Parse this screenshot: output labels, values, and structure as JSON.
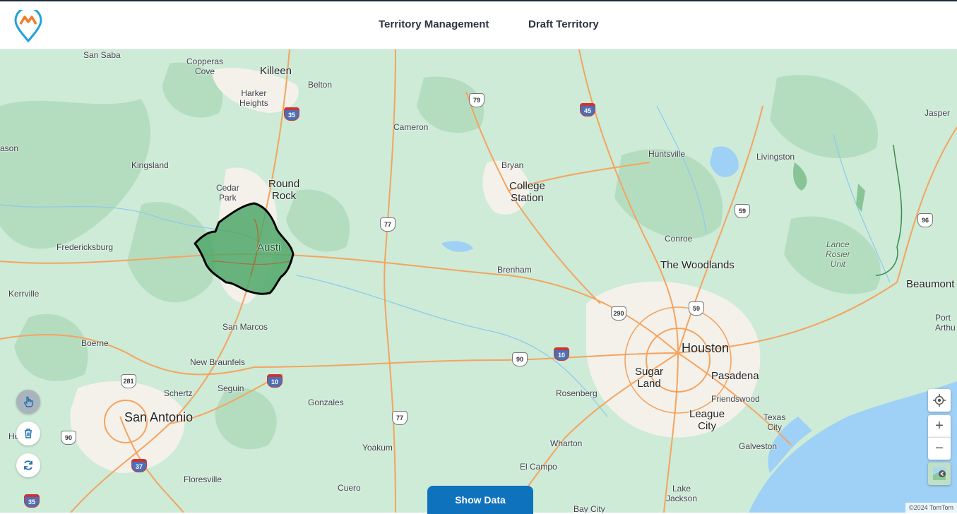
{
  "header": {
    "nav": [
      "Territory Management",
      "Draft Territory"
    ]
  },
  "map": {
    "cities": [
      {
        "name": "San Saba",
        "size": "s"
      },
      {
        "name": "Copperas\nCove",
        "size": "s"
      },
      {
        "name": "Killeen",
        "size": "m"
      },
      {
        "name": "Belton",
        "size": "s"
      },
      {
        "name": "Harker\nHeights",
        "size": "s"
      },
      {
        "name": "Cameron",
        "size": "s"
      },
      {
        "name": "Jasper",
        "size": "s"
      },
      {
        "name": "ason",
        "size": "s"
      },
      {
        "name": "Kingsland",
        "size": "s"
      },
      {
        "name": "Huntsville",
        "size": "s"
      },
      {
        "name": "Livingston",
        "size": "s"
      },
      {
        "name": "Bryan",
        "size": "s"
      },
      {
        "name": "College\nStation",
        "size": "m"
      },
      {
        "name": "Cedar\nPark",
        "size": "s"
      },
      {
        "name": "Round\nRock",
        "size": "m"
      },
      {
        "name": "Fredericksburg",
        "size": "s"
      },
      {
        "name": "Austi",
        "size": "m"
      },
      {
        "name": "Conroe",
        "size": "s"
      },
      {
        "name": "The Woodlands",
        "size": "m"
      },
      {
        "name": "Brenham",
        "size": "s"
      },
      {
        "name": "Kerrville",
        "size": "s"
      },
      {
        "name": "Beaumont",
        "size": "m"
      },
      {
        "name": "Port\nArthu",
        "size": "s"
      },
      {
        "name": "San Marcos",
        "size": "s"
      },
      {
        "name": "Houston",
        "size": "b"
      },
      {
        "name": "Boerne",
        "size": "s"
      },
      {
        "name": "New Braunfels",
        "size": "s"
      },
      {
        "name": "Sugar\nLand",
        "size": "m"
      },
      {
        "name": "Pasadena",
        "size": "m"
      },
      {
        "name": "Schertz",
        "size": "s"
      },
      {
        "name": "Seguin",
        "size": "s"
      },
      {
        "name": "Rosenberg",
        "size": "s"
      },
      {
        "name": "Friendswood",
        "size": "s"
      },
      {
        "name": "Gonzales",
        "size": "s"
      },
      {
        "name": "San Antonio",
        "size": "b"
      },
      {
        "name": "League\nCity",
        "size": "m"
      },
      {
        "name": "Texas\nCity",
        "size": "s"
      },
      {
        "name": "Ho",
        "size": "s"
      },
      {
        "name": "Yoakum",
        "size": "s"
      },
      {
        "name": "Wharton",
        "size": "s"
      },
      {
        "name": "Galveston",
        "size": "s"
      },
      {
        "name": "El Campo",
        "size": "s"
      },
      {
        "name": "Floresville",
        "size": "s"
      },
      {
        "name": "Cuero",
        "size": "s"
      },
      {
        "name": "Lake\nJackson",
        "size": "s"
      },
      {
        "name": "Bay City",
        "size": "s"
      }
    ],
    "park_label": "Lance\nRosier\nUnit",
    "shields": [
      {
        "num": "35",
        "type": "int"
      },
      {
        "num": "79",
        "type": "us"
      },
      {
        "num": "45",
        "type": "int"
      },
      {
        "num": "59",
        "type": "us"
      },
      {
        "num": "96",
        "type": "us"
      },
      {
        "num": "77",
        "type": "us"
      },
      {
        "num": "290",
        "type": "us"
      },
      {
        "num": "59",
        "type": "us"
      },
      {
        "num": "90",
        "type": "us"
      },
      {
        "num": "10",
        "type": "int"
      },
      {
        "num": "281",
        "type": "us"
      },
      {
        "num": "10",
        "type": "int"
      },
      {
        "num": "77",
        "type": "us"
      },
      {
        "num": "90",
        "type": "us"
      },
      {
        "num": "37",
        "type": "int"
      },
      {
        "num": "35",
        "type": "int"
      }
    ],
    "attribution": "©2024 TomTom"
  },
  "tools": {
    "icons": [
      "hand-pointer-icon",
      "trash-icon",
      "refresh-icon"
    ]
  },
  "controls": {
    "icons": [
      "locate-icon",
      "zoom-in-icon",
      "zoom-out-icon",
      "map-style-icon"
    ],
    "zoom_in": "+",
    "zoom_out": "−"
  },
  "show_data_label": "Show Data",
  "colors": {
    "accent": "#0e72bd",
    "territory_fill": "#4fa86a",
    "water": "#9fd0f5",
    "land": "#cdebd7"
  }
}
